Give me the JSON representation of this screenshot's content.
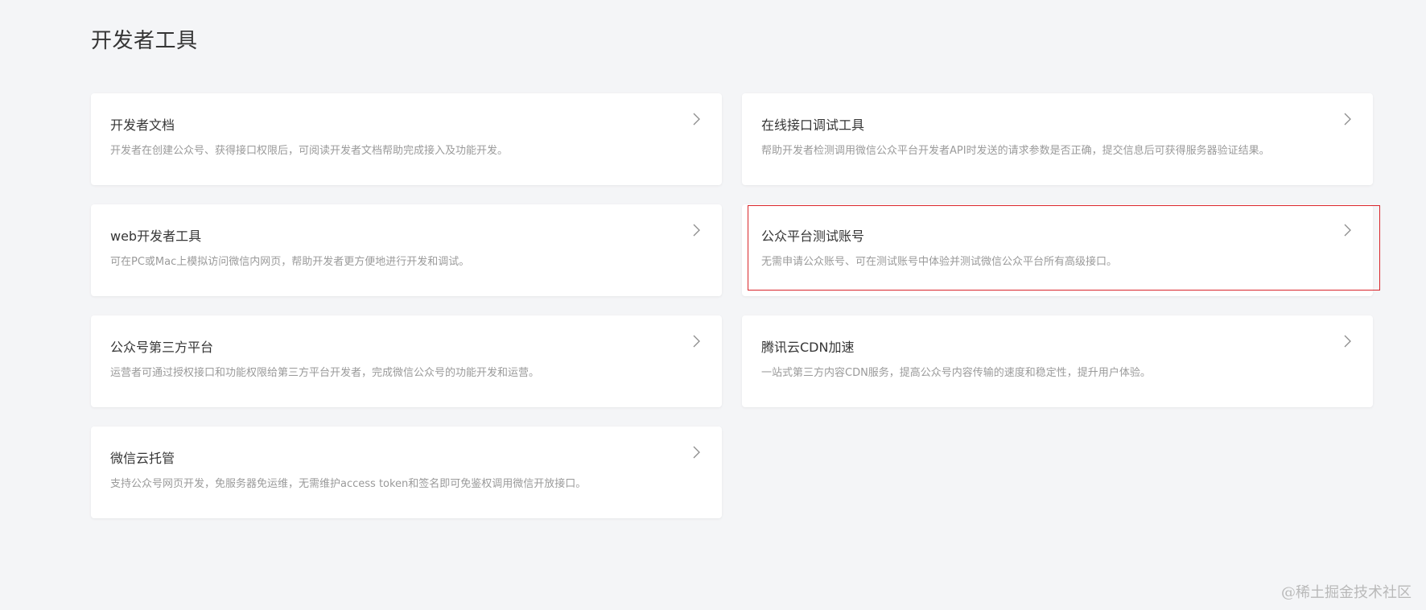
{
  "page": {
    "title": "开发者工具"
  },
  "cards": [
    {
      "title": "开发者文档",
      "description": "开发者在创建公众号、获得接口权限后，可阅读开发者文档帮助完成接入及功能开发。"
    },
    {
      "title": "在线接口调试工具",
      "description": "帮助开发者检测调用微信公众平台开发者API时发送的请求参数是否正确，提交信息后可获得服务器验证结果。"
    },
    {
      "title": "web开发者工具",
      "description": "可在PC或Mac上模拟访问微信内网页，帮助开发者更方便地进行开发和调试。"
    },
    {
      "title": "公众平台测试账号",
      "description": "无需申请公众账号、可在测试账号中体验并测试微信公众平台所有高级接口。"
    },
    {
      "title": "公众号第三方平台",
      "description": "运营者可通过授权接口和功能权限给第三方平台开发者，完成微信公众号的功能开发和运营。"
    },
    {
      "title": "腾讯云CDN加速",
      "description": "一站式第三方内容CDN服务，提高公众号内容传输的速度和稳定性，提升用户体验。"
    },
    {
      "title": "微信云托管",
      "description": "支持公众号网页开发，免服务器免运维，无需维护access token和签名即可免鉴权调用微信开放接口。"
    }
  ],
  "icons": {
    "chevron": "chevron-right-icon"
  },
  "colors": {
    "background": "#f4f5f7",
    "card": "#ffffff",
    "title": "#353535",
    "description": "#9a9a9a",
    "highlight": "#d9252b"
  },
  "watermark": "@稀土掘金技术社区"
}
